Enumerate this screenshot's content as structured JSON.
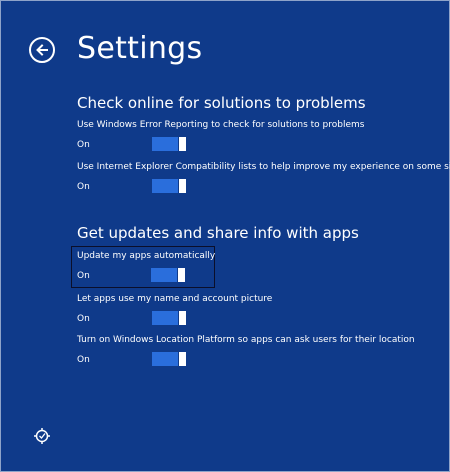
{
  "header": {
    "title": "Settings",
    "back_icon": "back-arrow-icon"
  },
  "sections": [
    {
      "title": "Check online for solutions to problems",
      "settings": [
        {
          "label": "Use Windows Error Reporting to check for solutions to problems",
          "state": "On",
          "on": true
        },
        {
          "label": "Use Internet Explorer Compatibility lists to help improve my experience on some sites",
          "state": "On",
          "on": true
        }
      ]
    },
    {
      "title": "Get updates and share info with apps",
      "settings": [
        {
          "label": "Update my apps automatically",
          "state": "On",
          "on": true,
          "focused": true
        },
        {
          "label": "Let apps use my name and account picture",
          "state": "On",
          "on": true
        },
        {
          "label": "Turn on Windows Location Platform so apps can ask users for their location",
          "state": "On",
          "on": true
        }
      ]
    }
  ],
  "footer": {
    "icon": "ease-of-access-icon"
  },
  "colors": {
    "background": "#0f3a8a",
    "toggle_on": "#2a6edc",
    "focus_border": "#0b0f2a"
  }
}
